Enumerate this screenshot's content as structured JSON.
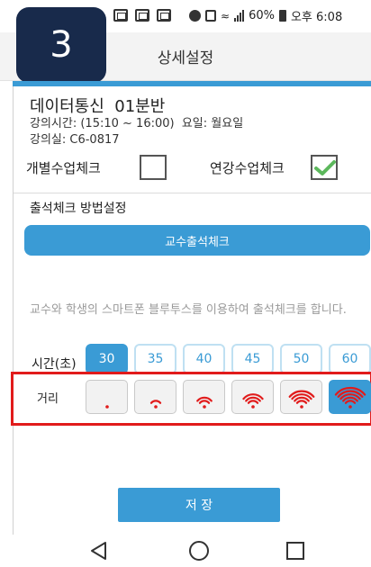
{
  "status_bar": {
    "battery": "60%",
    "time": "오후 6:08"
  },
  "step_badge": "3",
  "header": {
    "title": "상세설정"
  },
  "course": {
    "title": "데이터통신  01분반",
    "time_line": "강의시간: (15:10 ~ 16:00)  요일: 월요일",
    "room_line": "강의실: C6-0817"
  },
  "checks": {
    "individual_label": "개별수업체크",
    "individual_checked": false,
    "cancel_label": "연강수업체크",
    "cancel_checked": true
  },
  "method": {
    "label": "출석체크 방법설정",
    "button": "교수출석체크"
  },
  "description": "교수와 학생의 스마트폰 블루투스를 이용하여 출석체크를 합니다.",
  "time_setting": {
    "label": "시간(초)",
    "options": [
      "30",
      "35",
      "40",
      "45",
      "50",
      "60"
    ],
    "selected": "30"
  },
  "distance_setting": {
    "label": "거리",
    "levels": [
      1,
      2,
      3,
      4,
      5,
      6
    ],
    "selected_level": 6
  },
  "save_button": "저 장",
  "icons": {
    "back": "back-triangle-icon",
    "home": "home-circle-icon",
    "recent": "recent-square-icon",
    "checkmark": "checkmark-icon",
    "wifi": "wifi-signal-icon"
  },
  "colors": {
    "accent": "#3a9bd5",
    "highlight": "#e11b1b",
    "badge": "#182a4b",
    "check_green": "#5cb85c"
  }
}
